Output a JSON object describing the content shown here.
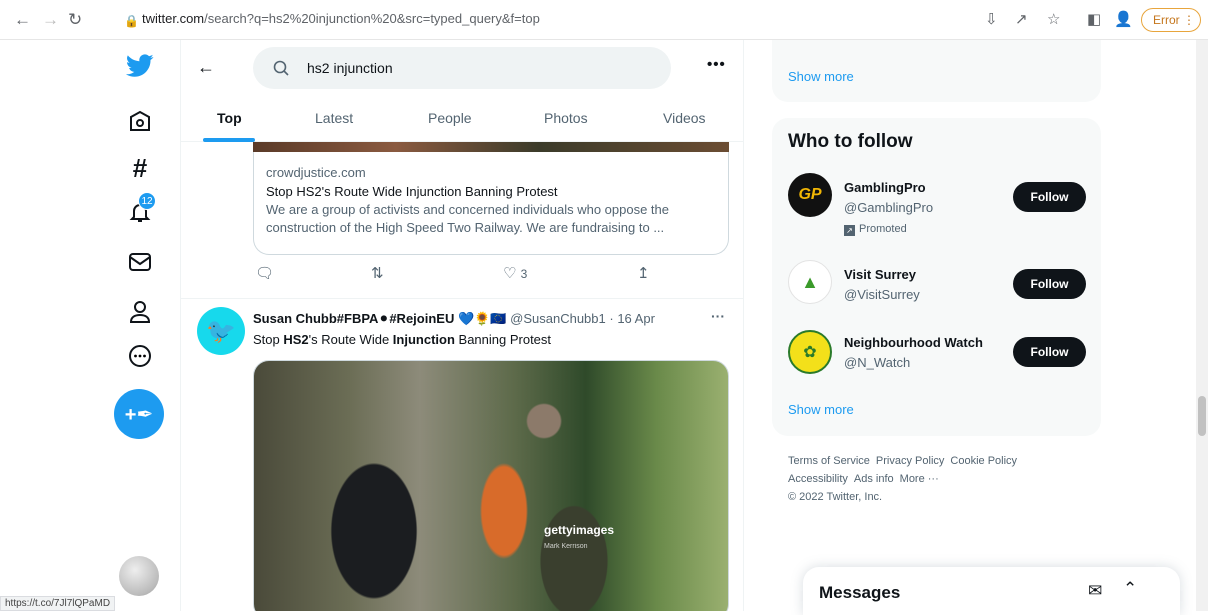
{
  "browser": {
    "url_host": "twitter.com",
    "url_path": "/search?q=hs2%20injunction%20&src=typed_query&f=top",
    "error_label": "Error",
    "status_link": "https://t.co/7Jl7lQPaMD"
  },
  "nav": {
    "notification_count": "12"
  },
  "search": {
    "query": "hs2 injunction",
    "more": "•••"
  },
  "tabs": [
    "Top",
    "Latest",
    "People",
    "Photos",
    "Videos"
  ],
  "tweet1": {
    "card_domain": "crowdjustice.com",
    "card_title": "Stop HS2's Route Wide Injunction Banning Protest",
    "card_desc": "We are a group of activists and concerned individuals who oppose the construction of the High Speed Two Railway. We are fundraising to ...",
    "likes": "3"
  },
  "tweet2": {
    "name": "Susan Chubb#FBPA⚫#RejoinEU 💙🌻🇪🇺",
    "handle": "@SusanChubb1",
    "date": "16 Apr",
    "text_pre": "Stop ",
    "text_b1": "HS2",
    "text_mid": "'s Route Wide ",
    "text_b2": "Injunction",
    "text_post": " Banning Protest",
    "photo_watermark": "gettyimages",
    "photo_credit": "Mark Kerrison"
  },
  "trends": {
    "show_more": "Show more"
  },
  "who_to_follow": {
    "title": "Who to follow",
    "accounts": [
      {
        "name": "GamblingPro",
        "handle": "@GamblingPro",
        "promoted": "Promoted",
        "button": "Follow"
      },
      {
        "name": "Visit Surrey",
        "handle": "@VisitSurrey",
        "button": "Follow"
      },
      {
        "name": "Neighbourhood Watch",
        "handle": "@N_Watch",
        "button": "Follow"
      }
    ],
    "show_more": "Show more"
  },
  "footer": {
    "links": [
      "Terms of Service",
      "Privacy Policy",
      "Cookie Policy",
      "Accessibility",
      "Ads info",
      "More ···"
    ],
    "copyright": "© 2022 Twitter, Inc."
  },
  "messages": {
    "title": "Messages"
  },
  "colors": {
    "accent": "#1d9bf0",
    "text": "#0f1419",
    "muted": "#536471"
  }
}
